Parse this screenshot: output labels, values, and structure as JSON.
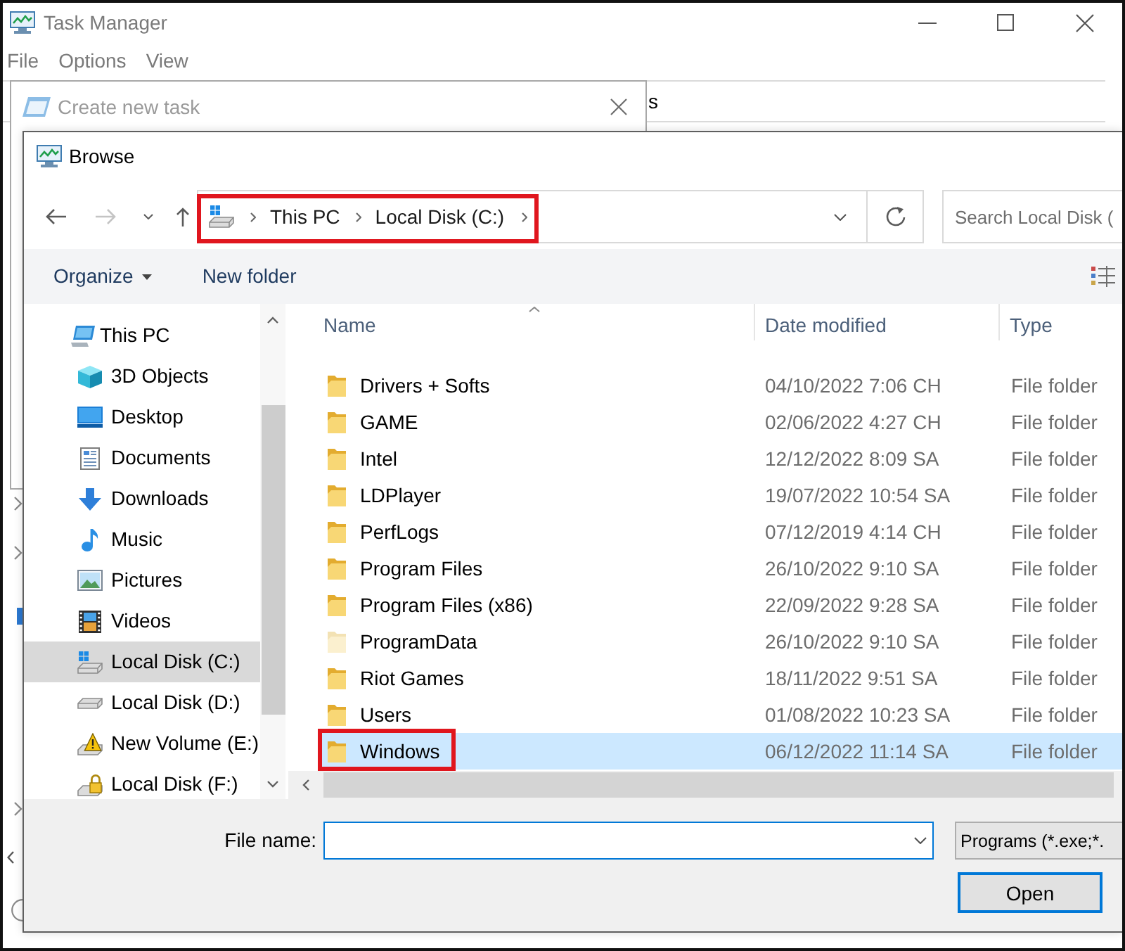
{
  "task_manager": {
    "title": "Task Manager",
    "active": false,
    "menu": [
      "File",
      "Options",
      "View"
    ],
    "tab_label_fragment": "s"
  },
  "create_task_dialog": {
    "title": "Create new task",
    "active": false
  },
  "browse_dialog": {
    "title": "Browse",
    "active": true,
    "forward_disabled": true,
    "address": {
      "crumbs": [
        "This PC",
        "Local Disk (C:)"
      ],
      "highlighted": true
    },
    "search": {
      "placeholder": "Search Local Disk ("
    },
    "toolbar": [
      {
        "label": "Organize",
        "kind": "menu"
      },
      {
        "label": "New folder",
        "kind": "button"
      }
    ],
    "nav": [
      {
        "label": "This PC",
        "kind": "computer",
        "selected": false,
        "children": [
          {
            "label": "3D Objects",
            "kind": "objects-3d",
            "selected": false
          },
          {
            "label": "Desktop",
            "kind": "desktop",
            "selected": false
          },
          {
            "label": "Documents",
            "kind": "documents",
            "selected": false
          },
          {
            "label": "Downloads",
            "kind": "downloads",
            "selected": false
          },
          {
            "label": "Music",
            "kind": "music",
            "selected": false
          },
          {
            "label": "Pictures",
            "kind": "pictures",
            "selected": false
          },
          {
            "label": "Videos",
            "kind": "videos",
            "selected": false
          },
          {
            "label": "Local Disk (C:)",
            "kind": "system-drive",
            "selected": true
          },
          {
            "label": "Local Disk (D:)",
            "kind": "drive",
            "selected": false
          },
          {
            "label": "New Volume (E:)",
            "kind": "drive-warning",
            "selected": false
          },
          {
            "label": "Local Disk (F:)",
            "kind": "drive-locked",
            "selected": false
          }
        ]
      }
    ],
    "columns": [
      {
        "label": "Name",
        "sorted": true
      },
      {
        "label": "Date modified",
        "sorted": false
      },
      {
        "label": "Type",
        "sorted": false
      }
    ],
    "rows": [
      {
        "name": "Drivers + Softs",
        "date": "04/10/2022 7:06 CH",
        "type": "File folder",
        "hidden": false,
        "selected": false,
        "highlighted": false
      },
      {
        "name": "GAME",
        "date": "02/06/2022 4:27 CH",
        "type": "File folder",
        "hidden": false,
        "selected": false,
        "highlighted": false
      },
      {
        "name": "Intel",
        "date": "12/12/2022 8:09 SA",
        "type": "File folder",
        "hidden": false,
        "selected": false,
        "highlighted": false
      },
      {
        "name": "LDPlayer",
        "date": "19/07/2022 10:54 SA",
        "type": "File folder",
        "hidden": false,
        "selected": false,
        "highlighted": false
      },
      {
        "name": "PerfLogs",
        "date": "07/12/2019 4:14 CH",
        "type": "File folder",
        "hidden": false,
        "selected": false,
        "highlighted": false
      },
      {
        "name": "Program Files",
        "date": "26/10/2022 9:10 SA",
        "type": "File folder",
        "hidden": false,
        "selected": false,
        "highlighted": false
      },
      {
        "name": "Program Files (x86)",
        "date": "22/09/2022 9:28 SA",
        "type": "File folder",
        "hidden": false,
        "selected": false,
        "highlighted": false
      },
      {
        "name": "ProgramData",
        "date": "26/10/2022 9:10 SA",
        "type": "File folder",
        "hidden": true,
        "selected": false,
        "highlighted": false
      },
      {
        "name": "Riot Games",
        "date": "18/11/2022 9:51 SA",
        "type": "File folder",
        "hidden": false,
        "selected": false,
        "highlighted": false
      },
      {
        "name": "Users",
        "date": "01/08/2022 10:23 SA",
        "type": "File folder",
        "hidden": false,
        "selected": false,
        "highlighted": false
      },
      {
        "name": "Windows",
        "date": "06/12/2022 11:14 SA",
        "type": "File folder",
        "hidden": false,
        "selected": true,
        "highlighted": true
      }
    ],
    "file_name": {
      "label": "File name:"
    },
    "file_type": {
      "value": "Programs (*.exe;*."
    },
    "open_button": {
      "label": "Open"
    }
  }
}
